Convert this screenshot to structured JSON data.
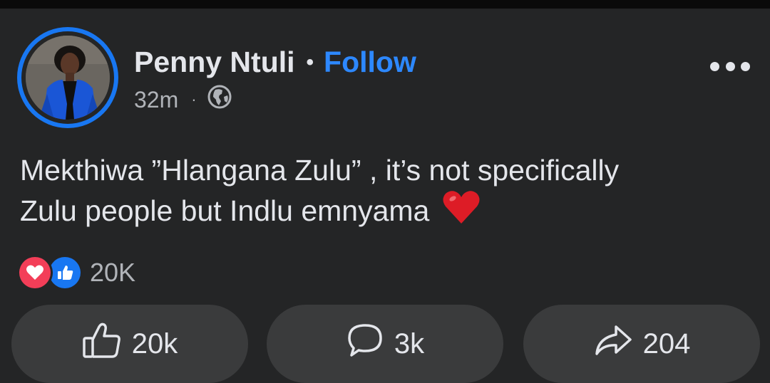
{
  "post": {
    "author": "Penny Ntuli",
    "separator": "•",
    "follow_label": "Follow",
    "time": "32m",
    "meta_separator": "·",
    "audience_icon": "globe-icon",
    "text_line1": "Mekthiwa ”Hlangana Zulu” , it’s not specifically",
    "text_line2": "Zulu people but Indlu emnyama",
    "emoji": "heart-emoji"
  },
  "reactions": {
    "icons": [
      "love-reaction-icon",
      "like-reaction-icon"
    ],
    "total": "20K"
  },
  "actions": {
    "like_count": "20k",
    "comment_count": "3k",
    "share_count": "204"
  },
  "colors": {
    "background": "#242526",
    "accent": "#2d88ff",
    "button": "#3a3b3c",
    "love": "#f33e58",
    "like": "#1877f2"
  }
}
